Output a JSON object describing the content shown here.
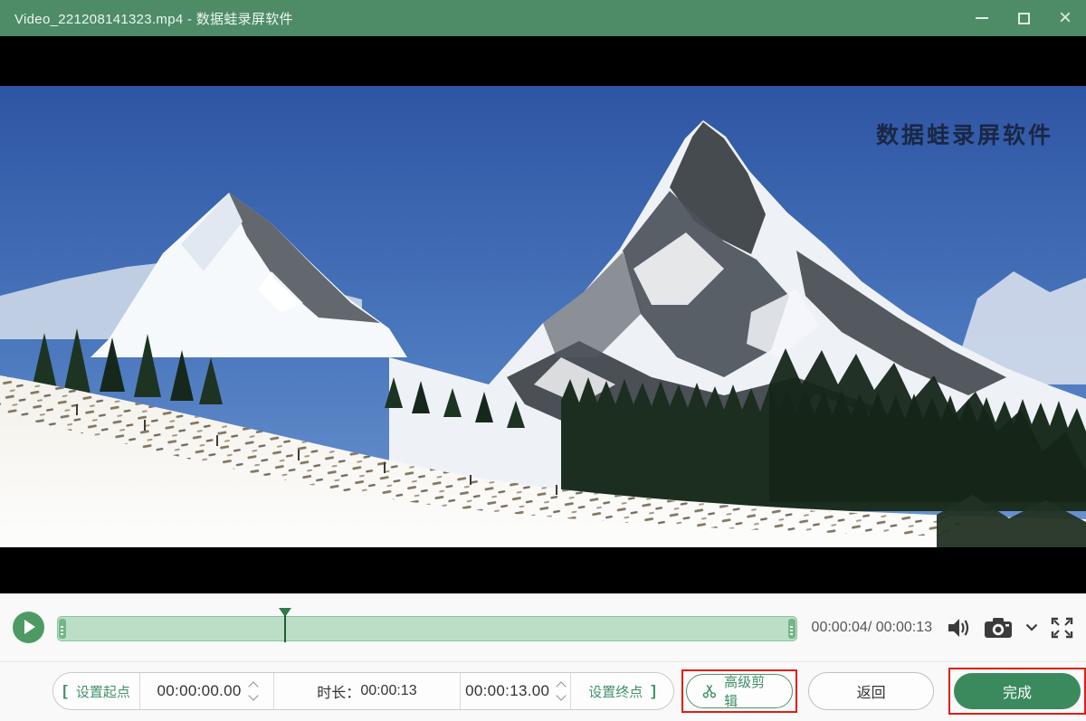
{
  "window": {
    "title": "Video_221208141323.mp4  -  数据蛙录屏软件",
    "controls": [
      "minimize",
      "maximize",
      "close"
    ]
  },
  "video": {
    "watermark": "数据蛙录屏软件",
    "scene": "snow-covered alpine mountains, blue sky, conifer forest, snowy foreground slope"
  },
  "playback": {
    "current_time": "00:00:04",
    "total_time": "00:00:13",
    "time_display": "00:00:04/ 00:00:13",
    "progress_percent": 30.8,
    "icons": [
      "play-icon",
      "volume-icon",
      "camera-snapshot-icon",
      "chevron-down-icon",
      "fullscreen-icon"
    ]
  },
  "trim_bar": {
    "start_bracket": "[",
    "set_start_label": "设置起点",
    "start_time_value": "00:00:00.00",
    "duration_label": "时长：",
    "duration_value": "00:00:13",
    "end_time_value": "00:00:13.00",
    "set_end_label": "设置终点",
    "end_bracket": "]",
    "advanced_edit_label": "高级剪辑",
    "advanced_edit_icon": "scissors-icon",
    "back_label": "返回",
    "done_label": "完成"
  },
  "colors": {
    "titlebar_green": "#4e8c68",
    "accent_green": "#3e8e63",
    "done_button_green": "#3a8a5e",
    "track_green": "#bcdec6",
    "playhead_green": "#2d7c45",
    "highlight_red": "#e11d17",
    "panel_bg": "#f8f9f8"
  }
}
